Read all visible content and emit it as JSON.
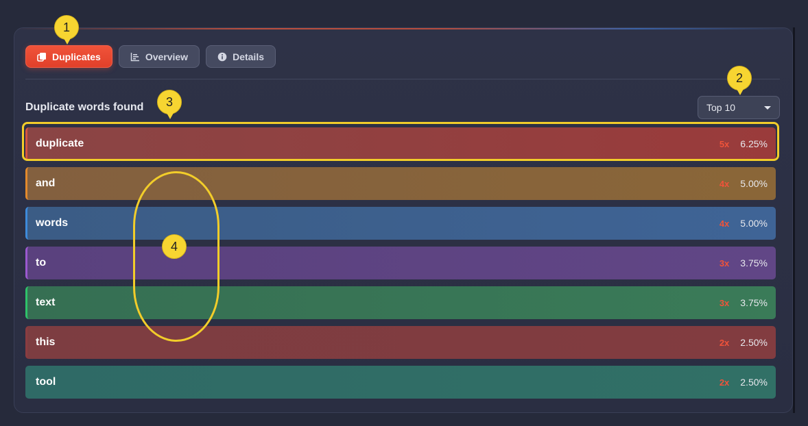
{
  "tabs": [
    {
      "label": "Duplicates",
      "icon": "copy-icon",
      "active": true
    },
    {
      "label": "Overview",
      "icon": "bar-chart-icon",
      "active": false
    },
    {
      "label": "Details",
      "icon": "info-icon",
      "active": false
    }
  ],
  "section_title": "Duplicate words found",
  "top_select": {
    "value": "Top 10"
  },
  "rows": [
    {
      "word": "duplicate",
      "count": "5x",
      "pct": "6.25%",
      "color": "#9a3b3b"
    },
    {
      "word": "and",
      "count": "4x",
      "pct": "5.00%",
      "color": "#8a6638"
    },
    {
      "word": "words",
      "count": "4x",
      "pct": "5.00%",
      "color": "#3f6496"
    },
    {
      "word": "to",
      "count": "3x",
      "pct": "3.75%",
      "color": "#614686"
    },
    {
      "word": "text",
      "count": "3x",
      "pct": "3.75%",
      "color": "#3a7b58"
    },
    {
      "word": "this",
      "count": "2x",
      "pct": "2.50%",
      "color": "#823c40"
    },
    {
      "word": "tool",
      "count": "2x",
      "pct": "2.50%",
      "color": "#317066"
    }
  ],
  "annotations": {
    "marker_1": "1",
    "marker_2": "2",
    "marker_3": "3",
    "marker_4": "4",
    "highlight_color": "#f2cd2a"
  },
  "colors": {
    "accent": "#f0533a",
    "background": "#262a3b",
    "panel": "#2e3247"
  }
}
